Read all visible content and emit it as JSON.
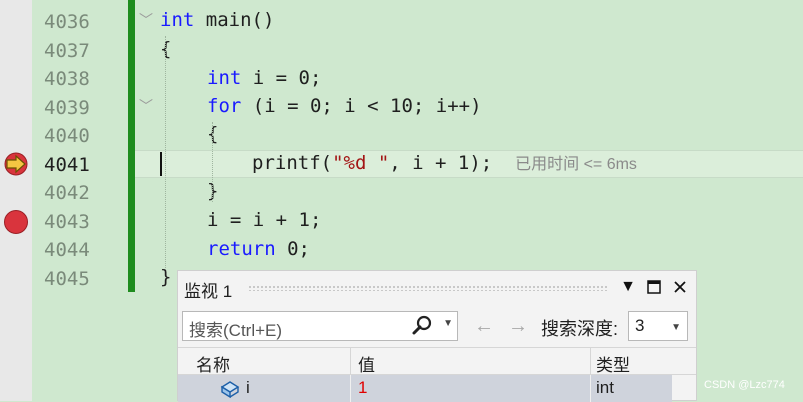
{
  "line_numbers": [
    "4036",
    "4037",
    "4038",
    "4039",
    "4040",
    "4041",
    "4042",
    "4043",
    "4044",
    "4045"
  ],
  "code": {
    "main_kw": "int",
    "main_rest": " main()",
    "open_brace": "{",
    "decl_kw": "int",
    "decl_rest": " i = 0;",
    "for_kw": "for",
    "for_rest": " (i = 0; i < 10; i++)",
    "for_open": "{",
    "printf_pre": "printf(",
    "printf_str": "\"%d \"",
    "printf_post": ", i + 1);",
    "perf_tip": "已用时间 <= 6ms",
    "for_close": "}",
    "assign": "i = i + 1;",
    "return_kw": "return",
    "return_rest": " 0;",
    "close_brace": "}"
  },
  "watch": {
    "title": "监视 1",
    "search_placeholder": "搜索(Ctrl+E)",
    "depth_label": "搜索深度:",
    "depth_value": "3",
    "columns": [
      "名称",
      "值",
      "类型"
    ],
    "rows": [
      {
        "name": "i",
        "value": "1",
        "type": "int"
      }
    ]
  },
  "watermark": "CSDN @Lzc774",
  "colors": {
    "editor_bg": "#cfe8cf",
    "keyword": "#1a1aff",
    "string": "#a31515",
    "changed_bar": "#1e8c1e",
    "breakpoint": "#d9343d",
    "current_statement": "#f5c542"
  }
}
